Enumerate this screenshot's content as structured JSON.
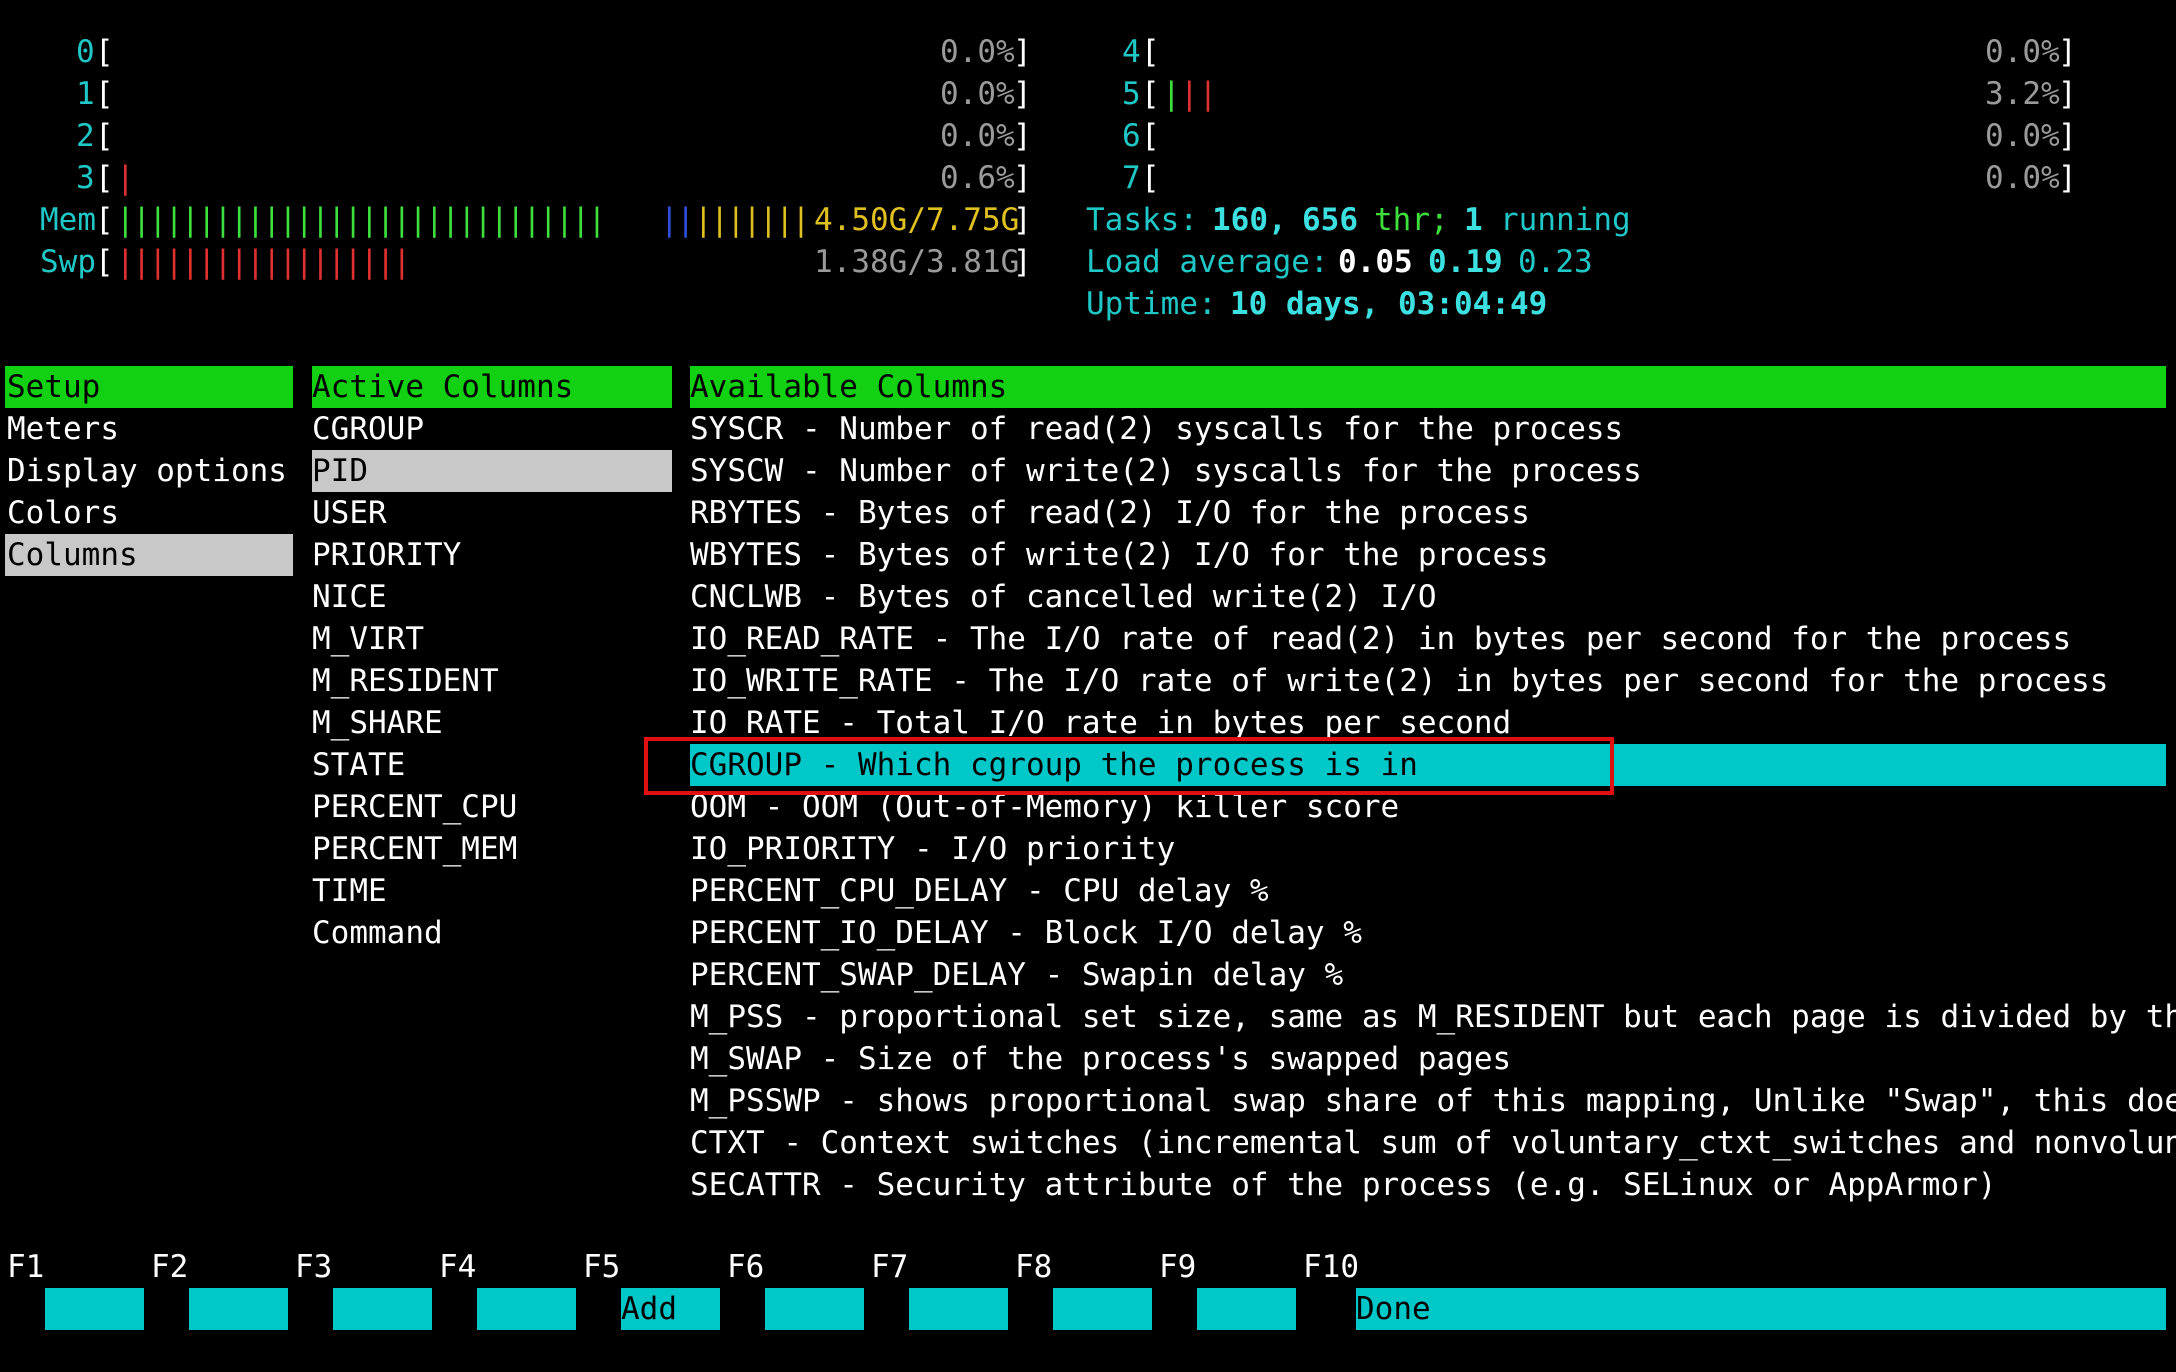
{
  "cpus": [
    {
      "id": "0",
      "value": "0.0%"
    },
    {
      "id": "1",
      "value": "0.0%"
    },
    {
      "id": "2",
      "value": "0.0%"
    },
    {
      "id": "3",
      "value": "0.6%"
    },
    {
      "id": "4",
      "value": "0.0%"
    },
    {
      "id": "5",
      "value": "3.2%"
    },
    {
      "id": "6",
      "value": "0.0%"
    },
    {
      "id": "7",
      "value": "0.0%"
    }
  ],
  "mem": {
    "label": "Mem",
    "value": "4.50G/7.75G",
    "bars_green": "||||||||||||||||||||||||||||||",
    "bars_blue": "||",
    "bars_yellow": "|||||||"
  },
  "swp": {
    "label": "Swp",
    "value": "1.38G/3.81G",
    "bars_red": "||||||||||||||||||"
  },
  "tasks": {
    "label": "Tasks:",
    "count": "160,",
    "threads": "656",
    "thr_label": "thr;",
    "running": "1",
    "running_label": "running"
  },
  "load": {
    "label": "Load average:",
    "v1": "0.05",
    "v2": "0.19",
    "v3": "0.23"
  },
  "uptime": {
    "label": "Uptime:",
    "value": "10 days, 03:04:49"
  },
  "setup": {
    "header": "Setup",
    "items": [
      "Meters",
      "Display options",
      "Colors",
      "Columns"
    ]
  },
  "active": {
    "header": "Active Columns",
    "items": [
      "CGROUP",
      "PID",
      "USER",
      "PRIORITY",
      "NICE",
      "M_VIRT",
      "M_RESIDENT",
      "M_SHARE",
      "STATE",
      "PERCENT_CPU",
      "PERCENT_MEM",
      "TIME",
      "Command"
    ]
  },
  "available": {
    "header": "Available Columns",
    "items": [
      "SYSCR - Number of read(2) syscalls for the process",
      "SYSCW - Number of write(2) syscalls for the process",
      "RBYTES - Bytes of read(2) I/O for the process",
      "WBYTES - Bytes of write(2) I/O for the process",
      "CNCLWB - Bytes of cancelled write(2) I/O",
      "IO_READ_RATE - The I/O rate of read(2) in bytes per second for the process",
      "IO_WRITE_RATE - The I/O rate of write(2) in bytes per second for the process",
      "IO_RATE - Total I/O rate in bytes per second",
      "CGROUP - Which cgroup the process is in",
      "OOM - OOM (Out-of-Memory) killer score",
      "IO_PRIORITY - I/O priority",
      "PERCENT_CPU_DELAY - CPU delay %",
      "PERCENT_IO_DELAY - Block I/O delay %",
      "PERCENT_SWAP_DELAY - Swapin delay %",
      "M_PSS - proportional set size, same as M_RESIDENT but each page is divided by the",
      "M_SWAP - Size of the process's swapped pages",
      "M_PSSWP - shows proportional swap share of this mapping, Unlike \"Swap\", this does",
      "CTXT - Context switches (incremental sum of voluntary_ctxt_switches and nonvolunta",
      "SECATTR - Security attribute of the process (e.g. SELinux or AppArmor)"
    ]
  },
  "fkeys": [
    {
      "key": "F1",
      "label": ""
    },
    {
      "key": "F2",
      "label": ""
    },
    {
      "key": "F3",
      "label": ""
    },
    {
      "key": "F4",
      "label": ""
    },
    {
      "key": "F5",
      "label": "Add"
    },
    {
      "key": "F6",
      "label": ""
    },
    {
      "key": "F7",
      "label": ""
    },
    {
      "key": "F8",
      "label": ""
    },
    {
      "key": "F9",
      "label": ""
    },
    {
      "key": "F10",
      "label": "Done"
    }
  ],
  "colors": {
    "header_green": "#12d012",
    "selection_gray": "#c8c8c8",
    "cyan": "#00c8c8",
    "highlight_red": "#e01010"
  }
}
